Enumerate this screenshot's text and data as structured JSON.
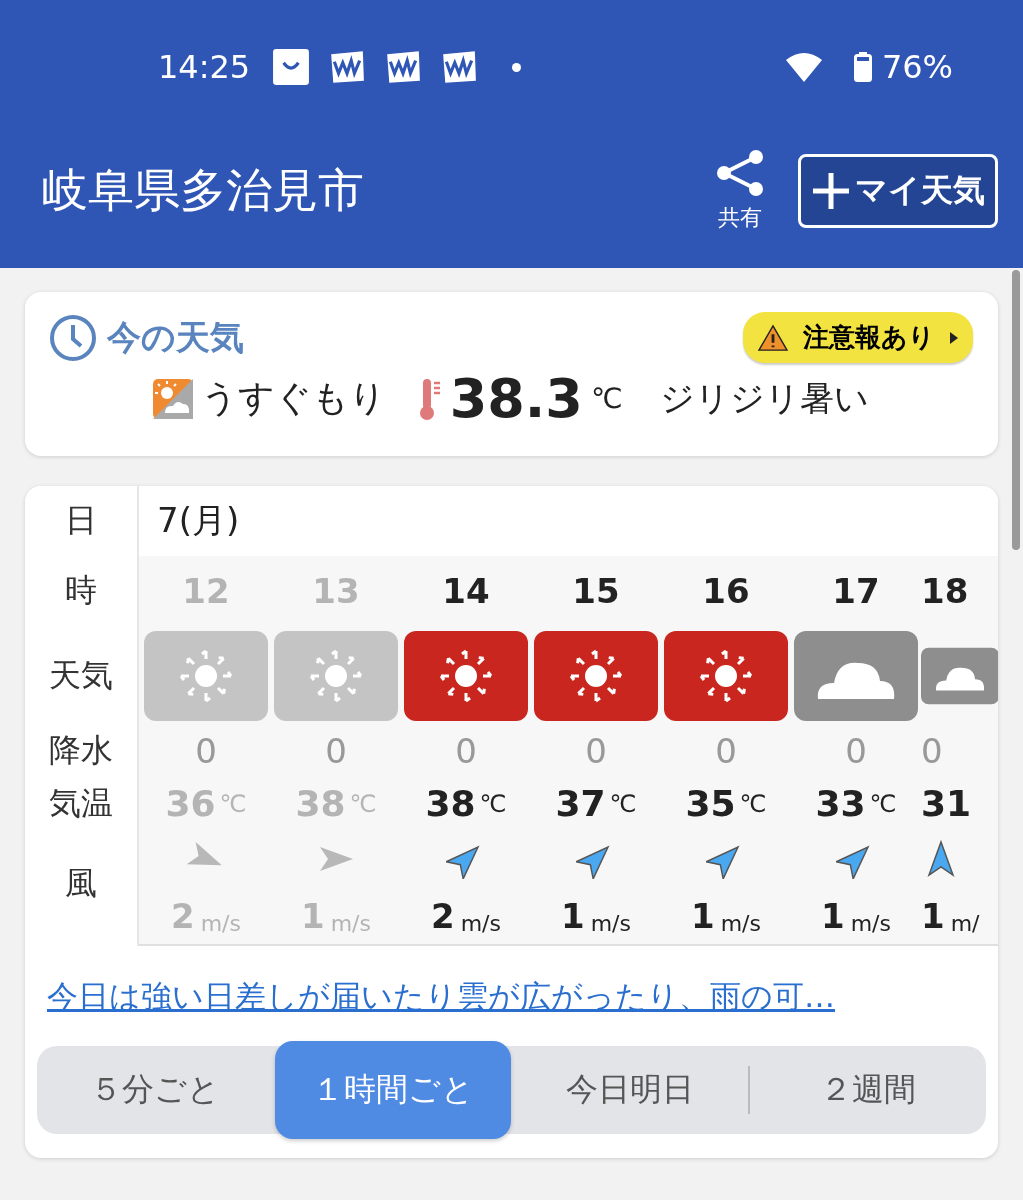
{
  "status_bar": {
    "time": "14:25",
    "notification_icons": [
      {
        "kind": "bag"
      },
      {
        "kind": "app"
      },
      {
        "kind": "app"
      },
      {
        "kind": "app"
      }
    ],
    "battery": "76%"
  },
  "header": {
    "title": "岐阜県多治見市",
    "share_label": "共有",
    "my_weather_button": "マイ天気"
  },
  "current": {
    "heading": "今の天気",
    "alert": "注意報あり",
    "condition": "うすぐもり",
    "temperature": "38.3",
    "temp_unit": "℃",
    "feel": "ジリジリ暑い"
  },
  "hourly": {
    "labels": {
      "day": "日",
      "hour": "時",
      "weather": "天気",
      "precip": "降水",
      "temp": "気温",
      "wind": "風"
    },
    "date": "7(月)",
    "columns": [
      {
        "hour": "12",
        "past": true,
        "kind": "sunny",
        "precip": "0",
        "temp": "36",
        "temp_unit": "℃",
        "wind_arrow": {
          "kind": "ese"
        },
        "wind": "2",
        "wind_unit": "m/s"
      },
      {
        "hour": "13",
        "past": true,
        "kind": "sunny",
        "precip": "0",
        "temp": "38",
        "temp_unit": "℃",
        "wind_arrow": {
          "kind": "e"
        },
        "wind": "1",
        "wind_unit": "m/s"
      },
      {
        "hour": "14",
        "past": false,
        "kind": "sunny",
        "precip": "0",
        "temp": "38",
        "temp_unit": "℃",
        "wind_arrow": {
          "kind": "ne"
        },
        "wind": "2",
        "wind_unit": "m/s"
      },
      {
        "hour": "15",
        "past": false,
        "kind": "sunny",
        "precip": "0",
        "temp": "37",
        "temp_unit": "℃",
        "wind_arrow": {
          "kind": "ne"
        },
        "wind": "1",
        "wind_unit": "m/s"
      },
      {
        "hour": "16",
        "past": false,
        "kind": "sunny",
        "precip": "0",
        "temp": "35",
        "temp_unit": "℃",
        "wind_arrow": {
          "kind": "ne"
        },
        "wind": "1",
        "wind_unit": "m/s"
      },
      {
        "hour": "17",
        "past": false,
        "kind": "cloudy",
        "precip": "0",
        "temp": "33",
        "temp_unit": "℃",
        "wind_arrow": {
          "kind": "ne"
        },
        "wind": "1",
        "wind_unit": "m/s"
      },
      {
        "hour": "18",
        "past": false,
        "kind": "cloudy",
        "precip": "0",
        "temp": "31",
        "wind_arrow": {
          "kind": "n"
        },
        "wind": "1",
        "wind_unit": "m/"
      }
    ]
  },
  "summary_link": "今日は強い日差しが届いたり雲が広がったり、雨の可…",
  "tabs": [
    {
      "label": "５分ごと",
      "selected": false
    },
    {
      "label": "１時間ごと",
      "selected": true
    },
    {
      "label": "今日明日",
      "selected": false
    },
    {
      "label": "２週間",
      "selected": false
    }
  ]
}
